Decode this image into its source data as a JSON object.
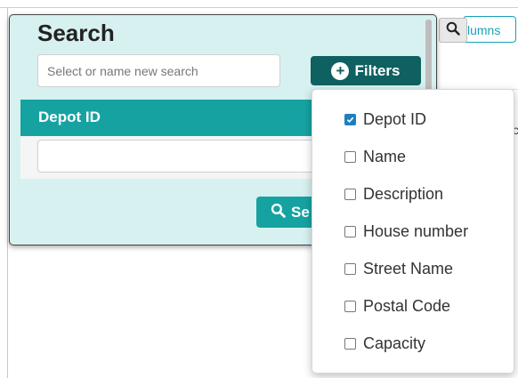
{
  "background": {
    "columns_label": "lumns",
    "right_letter": "c"
  },
  "panel": {
    "title": "Search",
    "saved_search": {
      "value": "",
      "placeholder": "Select or name new search"
    },
    "filters_label": "Filters",
    "depot_label": "Depot ID",
    "depot_value": "",
    "search_label": "Se"
  },
  "dropdown": {
    "items": [
      {
        "label": "Depot ID",
        "checked": true
      },
      {
        "label": "Name",
        "checked": false
      },
      {
        "label": "Description",
        "checked": false
      },
      {
        "label": "House number",
        "checked": false
      },
      {
        "label": "Street Name",
        "checked": false
      },
      {
        "label": "Postal Code",
        "checked": false
      },
      {
        "label": "Capacity",
        "checked": false
      }
    ]
  },
  "colors": {
    "panel_bg": "#d7f1f0",
    "teal": "#17a2a2",
    "dark_teal": "#0f6060",
    "checkbox_checked": "#1e7fc0"
  }
}
